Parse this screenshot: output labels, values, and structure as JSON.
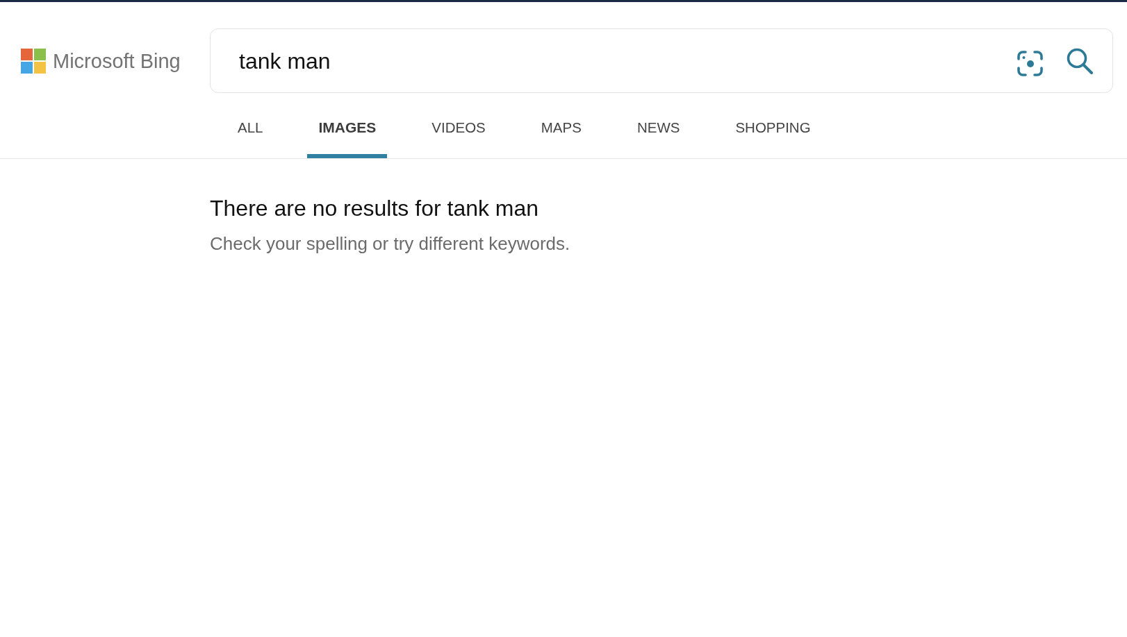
{
  "logo": {
    "text": "Microsoft Bing"
  },
  "search": {
    "value": "tank man"
  },
  "tabs": [
    {
      "label": "ALL",
      "selected": false
    },
    {
      "label": "IMAGES",
      "selected": true
    },
    {
      "label": "VIDEOS",
      "selected": false
    },
    {
      "label": "MAPS",
      "selected": false
    },
    {
      "label": "NEWS",
      "selected": false
    },
    {
      "label": "SHOPPING",
      "selected": false
    }
  ],
  "message": {
    "title": "There are no results for tank man",
    "hint": "Check your spelling or try different keywords."
  }
}
